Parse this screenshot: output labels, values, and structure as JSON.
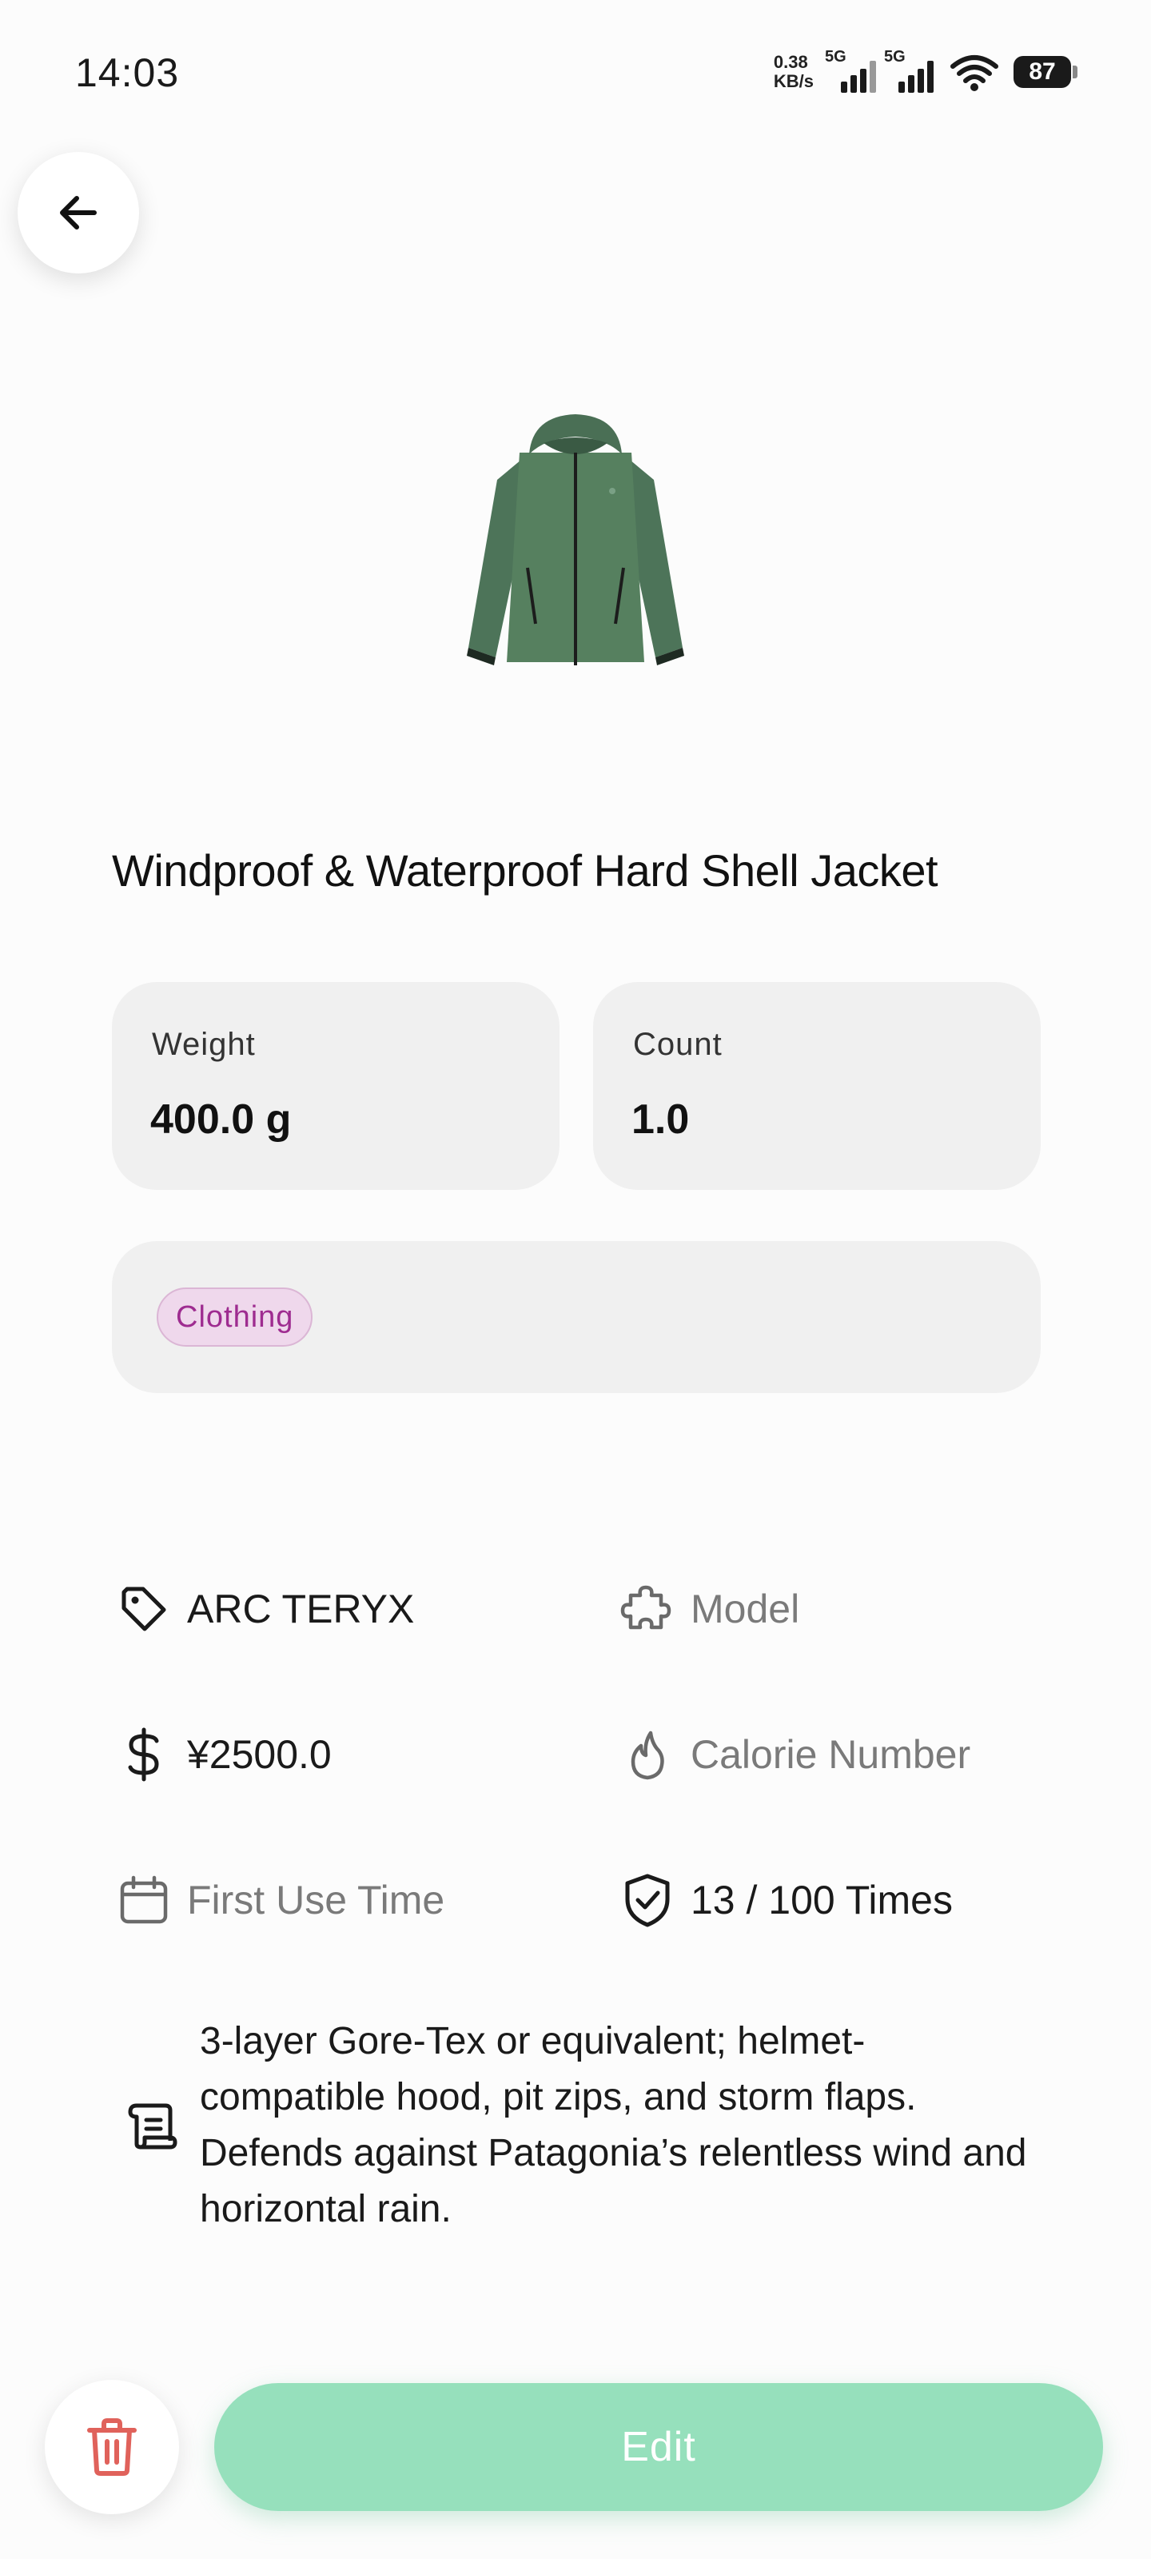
{
  "status_bar": {
    "time": "14:03",
    "net_speed_value": "0.38",
    "net_speed_unit": "KB/s",
    "network_1": "5G",
    "network_2": "5G",
    "battery": "87"
  },
  "icons": {
    "back": "arrow-left-icon",
    "brand": "tag-icon",
    "model": "puzzle-icon",
    "price": "dollar-icon",
    "calorie": "flame-icon",
    "first_use": "calendar-icon",
    "uses": "shield-check-icon",
    "description": "scroll-icon",
    "delete": "trash-icon"
  },
  "item": {
    "title": "Windproof & Waterproof Hard Shell Jacket",
    "weight_label": "Weight",
    "weight_value": "400.0 g",
    "count_label": "Count",
    "count_value": "1.0",
    "category": "Clothing",
    "brand": "ARC TERYX",
    "model_placeholder": "Model",
    "price": "¥2500.0",
    "calorie_placeholder": "Calorie Number",
    "first_use_placeholder": "First Use Time",
    "uses": "13 / 100 Times",
    "description": "3-layer Gore-Tex or equivalent; helmet-compatible hood, pit zips, and storm flaps. Defends against Patagonia’s relentless wind and horizontal rain."
  },
  "actions": {
    "edit_label": "Edit"
  },
  "colors": {
    "accent": "#96e0bc",
    "jacket": "#4f7a5c",
    "chip_bg": "#efd8ec",
    "chip_text": "#9e2c90",
    "delete": "#e0625b",
    "card_bg": "#f0f0f0"
  }
}
